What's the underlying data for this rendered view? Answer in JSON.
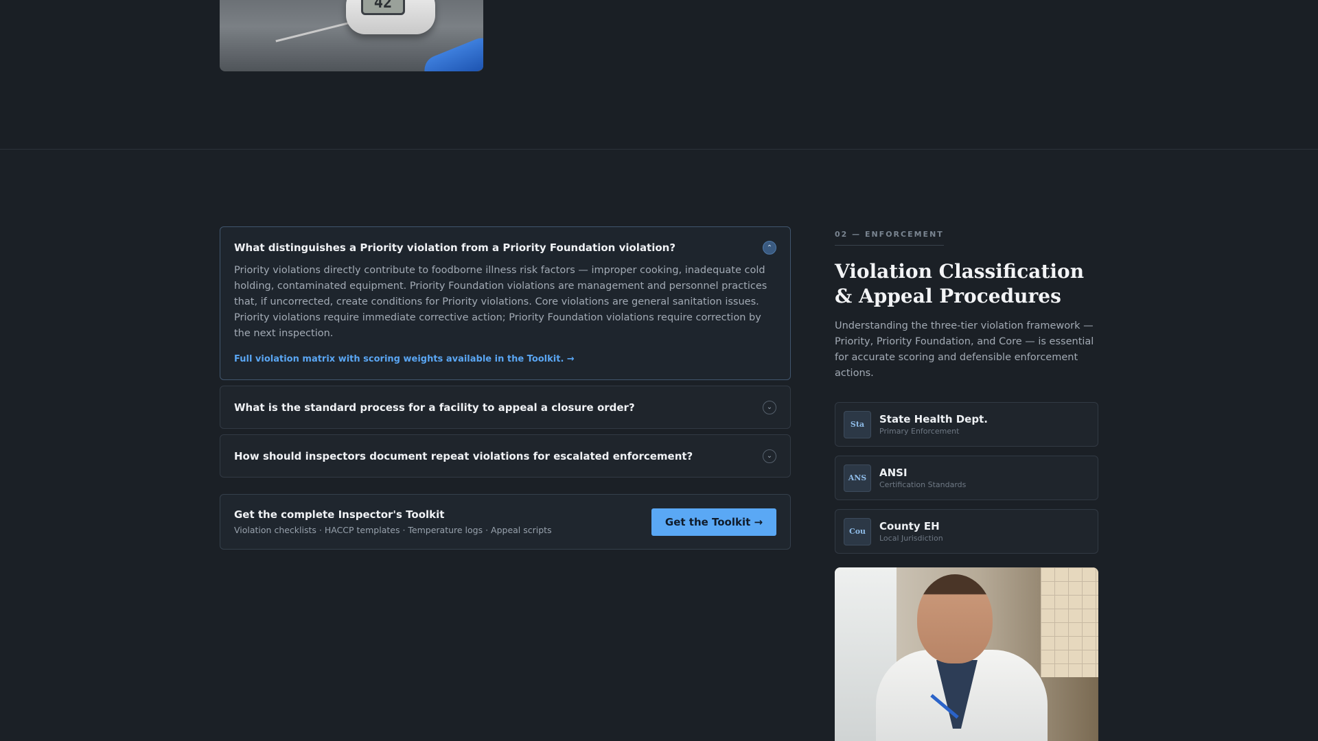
{
  "faq": {
    "items": [
      {
        "question": "What distinguishes a Priority violation from a Priority Foundation violation?",
        "answer": "Priority violations directly contribute to foodborne illness risk factors — improper cooking, inadequate cold holding, contaminated equipment. Priority Foundation violations are management and personnel practices that, if uncorrected, create conditions for Priority violations. Core violations are general sanitation issues. Priority violations require immediate corrective action; Priority Foundation violations require correction by the next inspection.",
        "link": "Full violation matrix with scoring weights available in the Toolkit. →",
        "open": true
      },
      {
        "question": "What is the standard process for a facility to appeal a closure order?",
        "open": false
      },
      {
        "question": "How should inspectors document repeat violations for escalated enforcement?",
        "open": false
      }
    ]
  },
  "cta": {
    "title": "Get the complete Inspector's Toolkit",
    "subtitle": "Violation checklists · HACCP templates · Temperature logs · Appeal scripts",
    "button": "Get the Toolkit →"
  },
  "side": {
    "kicker": "02 — ENFORCEMENT",
    "title": "Violation Classification & Appeal Procedures",
    "description": "Understanding the three-tier violation framework — Priority, Priority Foundation, and Core — is essential for accurate scoring and defensible enforcement actions.",
    "agencies": [
      {
        "badge": "Sta",
        "name": "State Health Dept.",
        "role": "Primary Enforcement"
      },
      {
        "badge": "ANS",
        "name": "ANSI",
        "role": "Certification Standards"
      },
      {
        "badge": "Cou",
        "name": "County EH",
        "role": "Local Jurisdiction"
      }
    ]
  },
  "photos": {
    "thermometer_display": "42"
  },
  "colors": {
    "accent": "#5aa8f5",
    "background": "#1b2026"
  }
}
